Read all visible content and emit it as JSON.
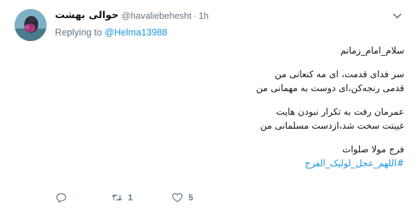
{
  "tweet": {
    "display_name": "حوالی بهشت",
    "handle": "@havaliebehesht",
    "separator": "·",
    "time": "1h",
    "reply": {
      "prefix": "Replying to",
      "mention": "@Helma13988"
    },
    "body": {
      "greeting": "سلام_امام_زمانم",
      "stanza1": [
        "سر فدای قدمت، ای مه کنعانی من",
        "قدمی رنجه‌کن،ای دوست به مهمانی من"
      ],
      "stanza2": [
        "عمرمان رفت به تکرار نبودن هایت",
        "غیبتت سخت شد،ازدست مسلمانی من"
      ],
      "closing": "فرج مولا صلوات",
      "hashtag": "#اللهم_عجل_لولیک_الفرج"
    },
    "actions": {
      "reply_icon": "reply-icon",
      "retweet_icon": "retweet-icon",
      "retweet_count": "1",
      "like_icon": "heart-icon",
      "like_count": "5"
    },
    "menu_icon": "chevron-down-icon"
  },
  "colors": {
    "text": "#14171a",
    "secondary": "#657786",
    "link": "#1b95e0"
  }
}
